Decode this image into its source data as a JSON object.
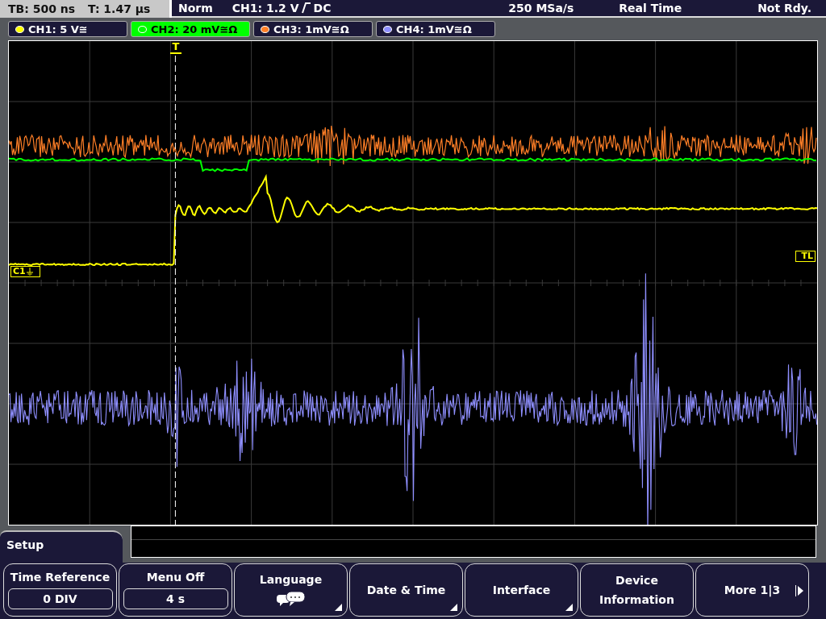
{
  "status_bar": {
    "timebase": "TB: 500 ns",
    "trigger_time": "T: 1.47 µs",
    "mode": "Norm",
    "trigger_level": "CH1: 1.2 V",
    "coupling": "DC",
    "sample_rate": "250 MSa/s",
    "acquisition": "Real Time",
    "state": "Not Rdy."
  },
  "channels": [
    {
      "label": "CH1: 5 V≅",
      "color": "#ffff00",
      "selected": false
    },
    {
      "label": "CH2: 20 mV≅Ω",
      "color": "#00ff00",
      "selected": true
    },
    {
      "label": "CH3: 1mV≅Ω",
      "color": "#ff7f27",
      "selected": false
    },
    {
      "label": "CH4: 1mV≅Ω",
      "color": "#8f8fff",
      "selected": false
    }
  ],
  "display": {
    "trigger_marker": "T",
    "channel_marker": "C1",
    "trigger_level_marker": "TL"
  },
  "menu": {
    "title": "Setup",
    "buttons": [
      {
        "label": "Time Reference",
        "value": "0 DIV",
        "kind": "value"
      },
      {
        "label": "Menu Off",
        "value": "4 s",
        "kind": "value"
      },
      {
        "label": "Language",
        "kind": "language"
      },
      {
        "label": "Date & Time",
        "kind": "submenu"
      },
      {
        "label": "Interface",
        "kind": "submenu"
      },
      {
        "label": "Device Information",
        "kind": "plain"
      },
      {
        "label": "More 1|3",
        "kind": "next"
      }
    ]
  }
}
